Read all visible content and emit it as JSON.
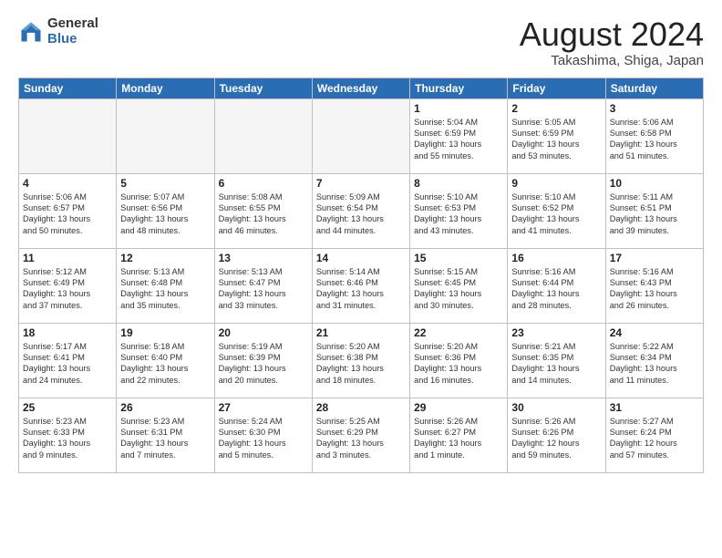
{
  "logo": {
    "general": "General",
    "blue": "Blue"
  },
  "header": {
    "month": "August 2024",
    "location": "Takashima, Shiga, Japan"
  },
  "days": [
    "Sunday",
    "Monday",
    "Tuesday",
    "Wednesday",
    "Thursday",
    "Friday",
    "Saturday"
  ],
  "weeks": [
    [
      {
        "day": "",
        "content": ""
      },
      {
        "day": "",
        "content": ""
      },
      {
        "day": "",
        "content": ""
      },
      {
        "day": "",
        "content": ""
      },
      {
        "day": "1",
        "content": "Sunrise: 5:04 AM\nSunset: 6:59 PM\nDaylight: 13 hours\nand 55 minutes."
      },
      {
        "day": "2",
        "content": "Sunrise: 5:05 AM\nSunset: 6:59 PM\nDaylight: 13 hours\nand 53 minutes."
      },
      {
        "day": "3",
        "content": "Sunrise: 5:06 AM\nSunset: 6:58 PM\nDaylight: 13 hours\nand 51 minutes."
      }
    ],
    [
      {
        "day": "4",
        "content": "Sunrise: 5:06 AM\nSunset: 6:57 PM\nDaylight: 13 hours\nand 50 minutes."
      },
      {
        "day": "5",
        "content": "Sunrise: 5:07 AM\nSunset: 6:56 PM\nDaylight: 13 hours\nand 48 minutes."
      },
      {
        "day": "6",
        "content": "Sunrise: 5:08 AM\nSunset: 6:55 PM\nDaylight: 13 hours\nand 46 minutes."
      },
      {
        "day": "7",
        "content": "Sunrise: 5:09 AM\nSunset: 6:54 PM\nDaylight: 13 hours\nand 44 minutes."
      },
      {
        "day": "8",
        "content": "Sunrise: 5:10 AM\nSunset: 6:53 PM\nDaylight: 13 hours\nand 43 minutes."
      },
      {
        "day": "9",
        "content": "Sunrise: 5:10 AM\nSunset: 6:52 PM\nDaylight: 13 hours\nand 41 minutes."
      },
      {
        "day": "10",
        "content": "Sunrise: 5:11 AM\nSunset: 6:51 PM\nDaylight: 13 hours\nand 39 minutes."
      }
    ],
    [
      {
        "day": "11",
        "content": "Sunrise: 5:12 AM\nSunset: 6:49 PM\nDaylight: 13 hours\nand 37 minutes."
      },
      {
        "day": "12",
        "content": "Sunrise: 5:13 AM\nSunset: 6:48 PM\nDaylight: 13 hours\nand 35 minutes."
      },
      {
        "day": "13",
        "content": "Sunrise: 5:13 AM\nSunset: 6:47 PM\nDaylight: 13 hours\nand 33 minutes."
      },
      {
        "day": "14",
        "content": "Sunrise: 5:14 AM\nSunset: 6:46 PM\nDaylight: 13 hours\nand 31 minutes."
      },
      {
        "day": "15",
        "content": "Sunrise: 5:15 AM\nSunset: 6:45 PM\nDaylight: 13 hours\nand 30 minutes."
      },
      {
        "day": "16",
        "content": "Sunrise: 5:16 AM\nSunset: 6:44 PM\nDaylight: 13 hours\nand 28 minutes."
      },
      {
        "day": "17",
        "content": "Sunrise: 5:16 AM\nSunset: 6:43 PM\nDaylight: 13 hours\nand 26 minutes."
      }
    ],
    [
      {
        "day": "18",
        "content": "Sunrise: 5:17 AM\nSunset: 6:41 PM\nDaylight: 13 hours\nand 24 minutes."
      },
      {
        "day": "19",
        "content": "Sunrise: 5:18 AM\nSunset: 6:40 PM\nDaylight: 13 hours\nand 22 minutes."
      },
      {
        "day": "20",
        "content": "Sunrise: 5:19 AM\nSunset: 6:39 PM\nDaylight: 13 hours\nand 20 minutes."
      },
      {
        "day": "21",
        "content": "Sunrise: 5:20 AM\nSunset: 6:38 PM\nDaylight: 13 hours\nand 18 minutes."
      },
      {
        "day": "22",
        "content": "Sunrise: 5:20 AM\nSunset: 6:36 PM\nDaylight: 13 hours\nand 16 minutes."
      },
      {
        "day": "23",
        "content": "Sunrise: 5:21 AM\nSunset: 6:35 PM\nDaylight: 13 hours\nand 14 minutes."
      },
      {
        "day": "24",
        "content": "Sunrise: 5:22 AM\nSunset: 6:34 PM\nDaylight: 13 hours\nand 11 minutes."
      }
    ],
    [
      {
        "day": "25",
        "content": "Sunrise: 5:23 AM\nSunset: 6:33 PM\nDaylight: 13 hours\nand 9 minutes."
      },
      {
        "day": "26",
        "content": "Sunrise: 5:23 AM\nSunset: 6:31 PM\nDaylight: 13 hours\nand 7 minutes."
      },
      {
        "day": "27",
        "content": "Sunrise: 5:24 AM\nSunset: 6:30 PM\nDaylight: 13 hours\nand 5 minutes."
      },
      {
        "day": "28",
        "content": "Sunrise: 5:25 AM\nSunset: 6:29 PM\nDaylight: 13 hours\nand 3 minutes."
      },
      {
        "day": "29",
        "content": "Sunrise: 5:26 AM\nSunset: 6:27 PM\nDaylight: 13 hours\nand 1 minute."
      },
      {
        "day": "30",
        "content": "Sunrise: 5:26 AM\nSunset: 6:26 PM\nDaylight: 12 hours\nand 59 minutes."
      },
      {
        "day": "31",
        "content": "Sunrise: 5:27 AM\nSunset: 6:24 PM\nDaylight: 12 hours\nand 57 minutes."
      }
    ]
  ]
}
